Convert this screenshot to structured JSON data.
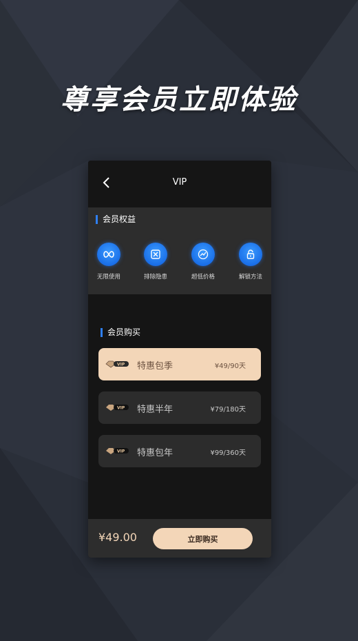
{
  "headline": "尊享会员立即体验",
  "nav": {
    "title": "VIP"
  },
  "benefits": {
    "title": "会员权益",
    "items": [
      {
        "label": "无限使用",
        "icon": "infinity-icon"
      },
      {
        "label": "排除隐患",
        "icon": "shield-x-icon"
      },
      {
        "label": "超低价格",
        "icon": "trend-icon"
      },
      {
        "label": "解锁方法",
        "icon": "unlock-icon"
      }
    ]
  },
  "purchase": {
    "title": "会员购买",
    "plans": [
      {
        "name": "特惠包季",
        "price": "¥49/90天",
        "badge": "VIP",
        "selected": true
      },
      {
        "name": "特惠半年",
        "price": "¥79/180天",
        "badge": "VIP",
        "selected": false
      },
      {
        "name": "特惠包年",
        "price": "¥99/360天",
        "badge": "VIP",
        "selected": false
      }
    ]
  },
  "footer": {
    "total": "¥49.00",
    "buy_label": "立即购买"
  },
  "colors": {
    "accent_blue": "#2f7ff0",
    "gold": "#f3d6b8",
    "dark": "#151515",
    "panel": "#2d2d2d"
  }
}
